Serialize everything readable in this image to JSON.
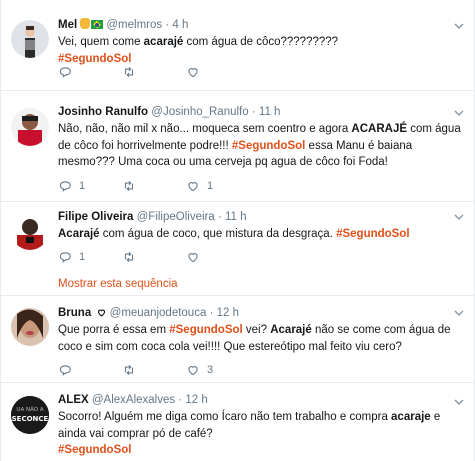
{
  "tweets": [
    {
      "name": "Mel",
      "handle": "@melmros",
      "time": "4 h",
      "segments": [
        {
          "t": "Vei, quem come ",
          "s": "n"
        },
        {
          "t": "acarajé",
          "s": "b"
        },
        {
          "t": " com água de côco?????????",
          "s": "n"
        },
        {
          "t": "\n",
          "s": "br"
        },
        {
          "t": "#SegundoSol",
          "s": "h"
        }
      ],
      "reply": "",
      "retweet": "",
      "like": "",
      "avatar_colors": [
        "#dfe3e8",
        "#2b2b2b",
        "#e8c4a8"
      ]
    },
    {
      "name": "Josinho Ranulfo",
      "handle": "@Josinho_Ranulfo",
      "time": "11 h",
      "segments": [
        {
          "t": "Não, não, não mil x não... moqueca sem coentro e agora ",
          "s": "n"
        },
        {
          "t": "ACARAJÉ",
          "s": "b"
        },
        {
          "t": " com água de côco  foi horrivelmente podre!!! ",
          "s": "n"
        },
        {
          "t": "#SegundoSol",
          "s": "h"
        },
        {
          "t": "  essa Manu é baiana mesmo??? Uma coca ou uma cerveja pq agua  de côco foi Foda!",
          "s": "n"
        }
      ],
      "reply": "1",
      "retweet": "",
      "like": "1",
      "avatar_colors": [
        "#c8102e",
        "#f2f2f2",
        "#1b1b1b"
      ]
    },
    {
      "name": "Filipe Oliveira",
      "handle": "@FilipeOliveira",
      "time": "11 h",
      "segments": [
        {
          "t": "Acarajé",
          "s": "b"
        },
        {
          "t": " com água de coco, que mistura da desgraça. ",
          "s": "n"
        },
        {
          "t": "#SegundoSol",
          "s": "h"
        }
      ],
      "reply": "1",
      "retweet": "",
      "like": "",
      "show_thread": "Mostrar esta sequência",
      "avatar_colors": [
        "#b31b1b",
        "#3a2a22",
        "#ffffff"
      ]
    },
    {
      "name": "Bruna",
      "handle": "@meuanjodetouca",
      "time": "12 h",
      "segments": [
        {
          "t": "Que porra é essa em ",
          "s": "n"
        },
        {
          "t": "#SegundoSol",
          "s": "h"
        },
        {
          "t": " vei? ",
          "s": "n"
        },
        {
          "t": "Acarajé",
          "s": "b"
        },
        {
          "t": " não se come com água de coco e sim com coca cola vei!!!! Que estereótipo mal feito viu cero?",
          "s": "n"
        }
      ],
      "reply": "",
      "retweet": "",
      "like": "3",
      "avatar_colors": [
        "#d9c2b0",
        "#3b2418",
        "#c99a7a"
      ]
    },
    {
      "name": "ALEX",
      "handle": "@AlexAlexalves",
      "time": "12 h",
      "segments": [
        {
          "t": "Socorro! Alguém me diga como  Ícaro não tem trabalho e compra  ",
          "s": "n"
        },
        {
          "t": "acaraje",
          "s": "b"
        },
        {
          "t": " e ainda vai comprar pó de café?",
          "s": "n"
        },
        {
          "t": "\n",
          "s": "br"
        },
        {
          "t": "#SegundoSol",
          "s": "h"
        }
      ],
      "reply": "",
      "retweet": "",
      "like": "",
      "avatar_text": [
        "UA NÃO A",
        "SECONCE"
      ],
      "avatar_colors": [
        "#1a1a1a",
        "#ffffff",
        "#555555"
      ]
    }
  ],
  "colors": {
    "hashtag": "#e0501a",
    "secondary_text": "#657786",
    "border": "#e6ecf0"
  },
  "icons": [
    "chevron-down-icon",
    "reply-icon",
    "retweet-icon",
    "like-icon",
    "brazil-flag-icon",
    "hand-emoji-icon",
    "heart-icon"
  ]
}
